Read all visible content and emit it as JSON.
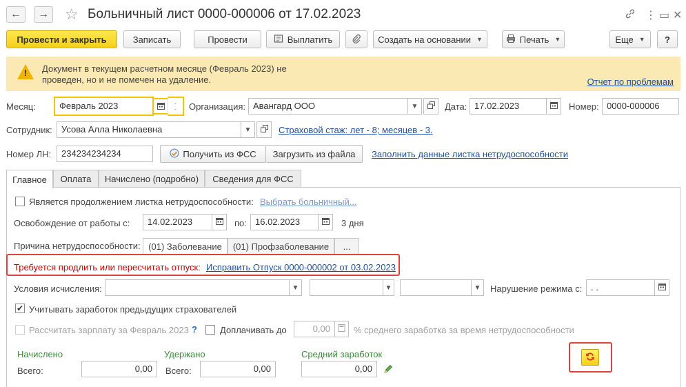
{
  "window": {
    "title": "Больничный лист 0000-000006 от 17.02.2023",
    "back": "←",
    "forward": "→",
    "favorite": "☆",
    "link_icon": "🔗",
    "menu_icon": "⋮",
    "restore_icon": "▭",
    "close_icon": "✕"
  },
  "toolbar": {
    "post_close": "Провести и закрыть",
    "save": "Записать",
    "post": "Провести",
    "pay": "Выплатить",
    "create_based": "Создать на основании",
    "print": "Печать",
    "more": "Еще",
    "help": "?"
  },
  "banner": {
    "message": "Документ в текущем расчетном месяце (Февраль 2023) не проведен, но и не помечен на удаление.",
    "problems_link": "Отчет по проблемам"
  },
  "header": {
    "month_label": "Месяц:",
    "month_value": "Февраль 2023",
    "org_label": "Организация:",
    "org_value": "Авангард ООО",
    "date_label": "Дата:",
    "date_value": "17.02.2023",
    "number_label": "Номер:",
    "number_value": "0000-000006",
    "employee_label": "Сотрудник:",
    "employee_value": "Усова Алла Николаевна",
    "insurance_link": "Страховой стаж: лет - 8; месяцев - 3.",
    "ln_label": "Номер ЛН:",
    "ln_value": "234234234234",
    "get_fss": "Получить из ФСС",
    "load_file": "Загрузить из файла",
    "fill_link": "Заполнить данные листка нетрудоспособности"
  },
  "tabs": [
    {
      "label": "Главное"
    },
    {
      "label": "Оплата"
    },
    {
      "label": "Начислено (подробно)"
    },
    {
      "label": "Сведения для ФСС"
    }
  ],
  "main": {
    "continuation_label": "Является продолжением листка нетрудоспособности:",
    "choose_link": "Выбрать больничный...",
    "release_label": "Освобождение от работы с:",
    "release_from": "14.02.2023",
    "to_label": "по:",
    "release_to": "16.02.2023",
    "days": "3 дня",
    "reason_label": "Причина нетрудоспособности:",
    "reason_disease": "(01) Заболевание",
    "reason_prof": "(01) Профзаболевание",
    "reason_more": "...",
    "warning_text": "Требуется продлить или пересчитать отпуск:",
    "fix_link": "Исправить Отпуск 0000-000002 от 03.02.2023",
    "conditions_label": "Условия исчисления:",
    "violation_label": "Нарушение режима с:",
    "violation_value": " .  .",
    "prev_insurers_label": "Учитывать заработок предыдущих страхователей",
    "calc_salary_label": "Рассчитать зарплату за Февраль 2023",
    "help_q": "?",
    "extra_pay_label": "Доплачивать до",
    "extra_pay_value": "0,00",
    "extra_pay_suffix": "% среднего заработка за время нетрудоспособности",
    "accrued_title": "Начислено",
    "withheld_title": "Удержано",
    "avg_title": "Средний заработок",
    "total_label": "Всего:",
    "accrued_total": "0,00",
    "withheld_total": "0,00",
    "avg_value": "0,00"
  }
}
